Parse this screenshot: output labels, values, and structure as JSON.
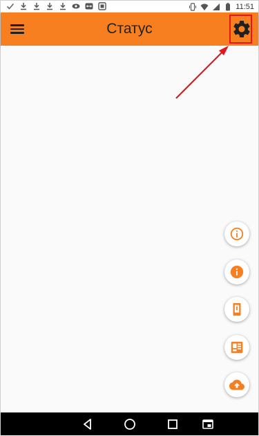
{
  "status_bar": {
    "time": "11:51",
    "left_icons": [
      "check-icon",
      "download-icon",
      "download-icon",
      "download-icon",
      "download-icon",
      "eye-icon",
      "teamviewer-icon",
      "screenshot-icon"
    ],
    "right_icons": [
      "vibrate-icon",
      "wifi-icon",
      "signal-icon",
      "battery-icon"
    ]
  },
  "app_bar": {
    "title": "Статус",
    "menu_icon": "hamburger-menu-icon",
    "settings_icon": "gear-icon",
    "background_color": "#f77f20"
  },
  "annotation": {
    "highlight_color": "#e4161c"
  },
  "fabs": [
    {
      "icon": "info-outline-icon"
    },
    {
      "icon": "info-filled-icon"
    },
    {
      "icon": "phone-device-icon"
    },
    {
      "icon": "dashboard-card-icon"
    },
    {
      "icon": "cloud-upload-icon"
    }
  ],
  "nav_bar": {
    "buttons": [
      "back-icon",
      "home-icon",
      "recents-icon",
      "picture-in-picture-icon"
    ]
  }
}
